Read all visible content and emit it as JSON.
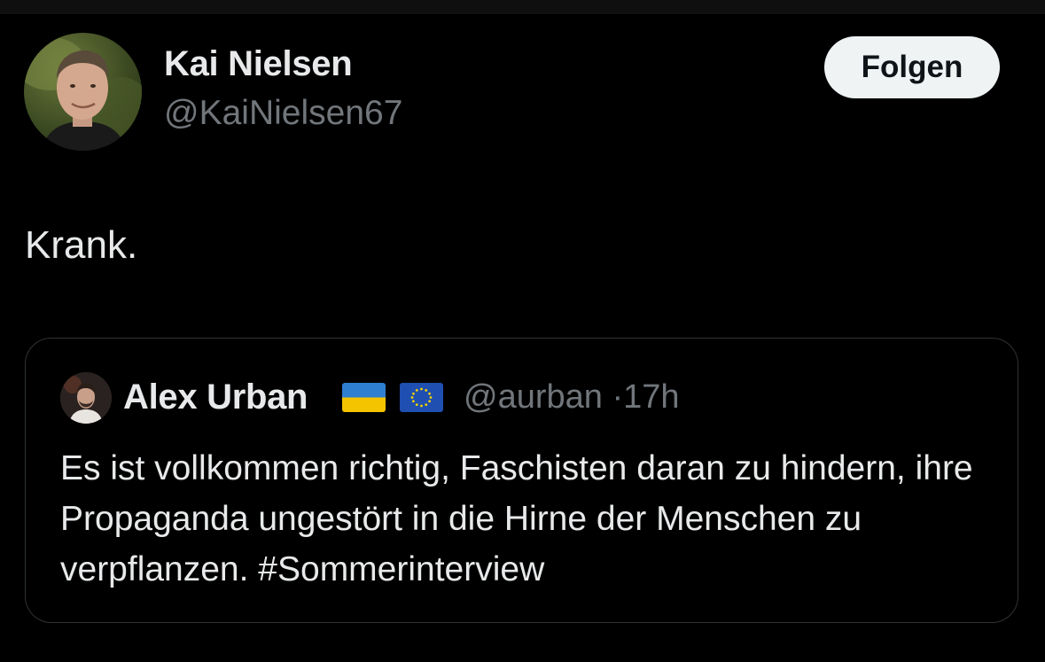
{
  "author": {
    "display_name": "Kai Nielsen",
    "handle": "@KaiNielsen67",
    "avatar_icon": "profile-photo"
  },
  "follow_button": {
    "label": "Folgen"
  },
  "post": {
    "text": "Krank."
  },
  "quoted_post": {
    "display_name": "Alex Urban",
    "flags": [
      "ukraine-flag-icon",
      "eu-flag-icon"
    ],
    "handle": "@aurban",
    "separator": "·",
    "time": "17h",
    "text": "Es ist vollkommen richtig, Faschisten daran zu hindern, ihre Propaganda ungestört in die Hirne der Menschen zu verpflanzen. #Sommerinterview"
  },
  "colors": {
    "background": "#000000",
    "text_primary": "#e7e9ea",
    "text_secondary": "#71767b",
    "card_border": "#2f3336",
    "button_background": "#eff3f4",
    "button_text": "#0f1419"
  }
}
